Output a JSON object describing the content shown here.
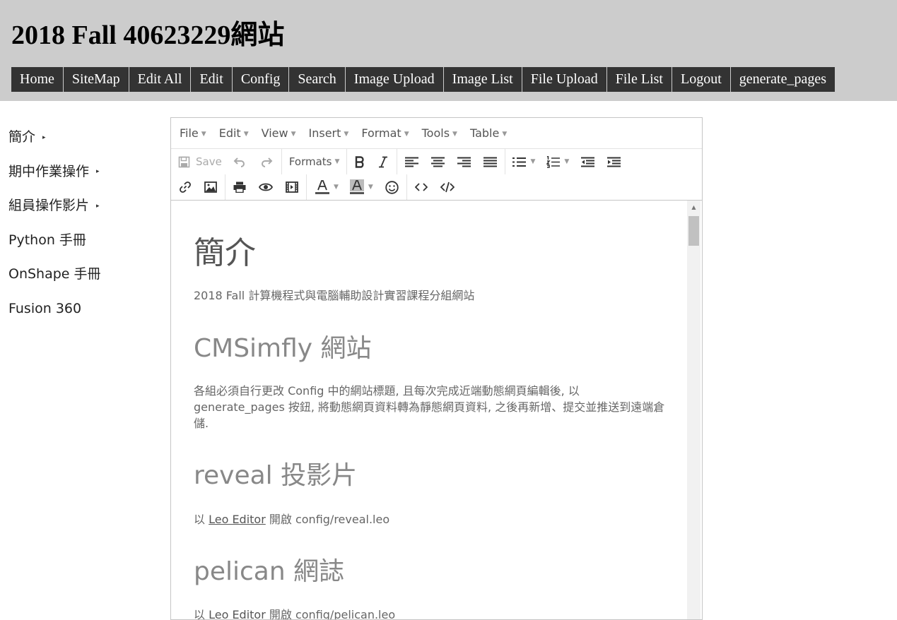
{
  "site": {
    "title": "2018 Fall 40623229網站"
  },
  "nav": {
    "home": "Home",
    "sitemap": "SiteMap",
    "edit_all": "Edit All",
    "edit": "Edit",
    "config": "Config",
    "search": "Search",
    "image_upload": "Image Upload",
    "image_list": "Image List",
    "file_upload": "File Upload",
    "file_list": "File List",
    "logout": "Logout",
    "generate_pages": "generate_pages"
  },
  "sidebar": {
    "items": [
      {
        "label": "簡介",
        "caret": "▸"
      },
      {
        "label": "期中作業操作",
        "caret": "▸"
      },
      {
        "label": "組員操作影片",
        "caret": "▸"
      },
      {
        "label": "Python 手冊"
      },
      {
        "label": "OnShape 手冊"
      },
      {
        "label": "Fusion 360"
      }
    ]
  },
  "editor": {
    "menu": {
      "file": "File",
      "edit": "Edit",
      "view": "View",
      "insert": "Insert",
      "format": "Format",
      "tools": "Tools",
      "table": "Table"
    },
    "toolbar": {
      "save": "Save",
      "formats": "Formats"
    },
    "content": {
      "h1": "簡介",
      "p1": "2018 Fall 計算機程式與電腦輔助設計實習課程分組網站",
      "h2_cms": "CMSimfly 網站",
      "p2": "各組必須自行更改 Config 中的網站標題, 且每次完成近端動態網頁編輯後, 以 generate_pages 按鈕, 將動態網頁資料轉為靜態網頁資料, 之後再新增、提交並推送到遠端倉儲.",
      "h2_reveal": "reveal 投影片",
      "p3_prefix": "以 ",
      "p3_link": "Leo Editor",
      "p3_suffix": " 開啟 config/reveal.leo",
      "h2_pelican": "pelican 網誌",
      "p4_prefix": "以 ",
      "p4_link": "Leo Editor",
      "p4_suffix": " 開啟 config/pelican.leo"
    }
  },
  "colors": {
    "header_bg": "#cccccc",
    "nav_bg": "#333333",
    "nav_text": "#ffffff"
  },
  "icons": {
    "save": "save-icon",
    "undo": "undo-icon",
    "redo": "redo-icon",
    "bold": "bold-icon",
    "italic": "italic-icon",
    "align_left": "align-left-icon",
    "align_center": "align-center-icon",
    "align_right": "align-right-icon",
    "justify": "align-justify-icon",
    "bullet_list": "bullet-list-icon",
    "numbered_list": "numbered-list-icon",
    "outdent": "outdent-icon",
    "indent": "indent-icon",
    "link": "link-icon",
    "image": "image-icon",
    "print": "print-icon",
    "preview": "preview-icon",
    "media": "media-icon",
    "text_color": "text-color-icon",
    "bg_color": "background-color-icon",
    "emoticons": "emoticons-icon",
    "code_sample": "code-sample-icon",
    "source_code": "source-code-icon"
  }
}
